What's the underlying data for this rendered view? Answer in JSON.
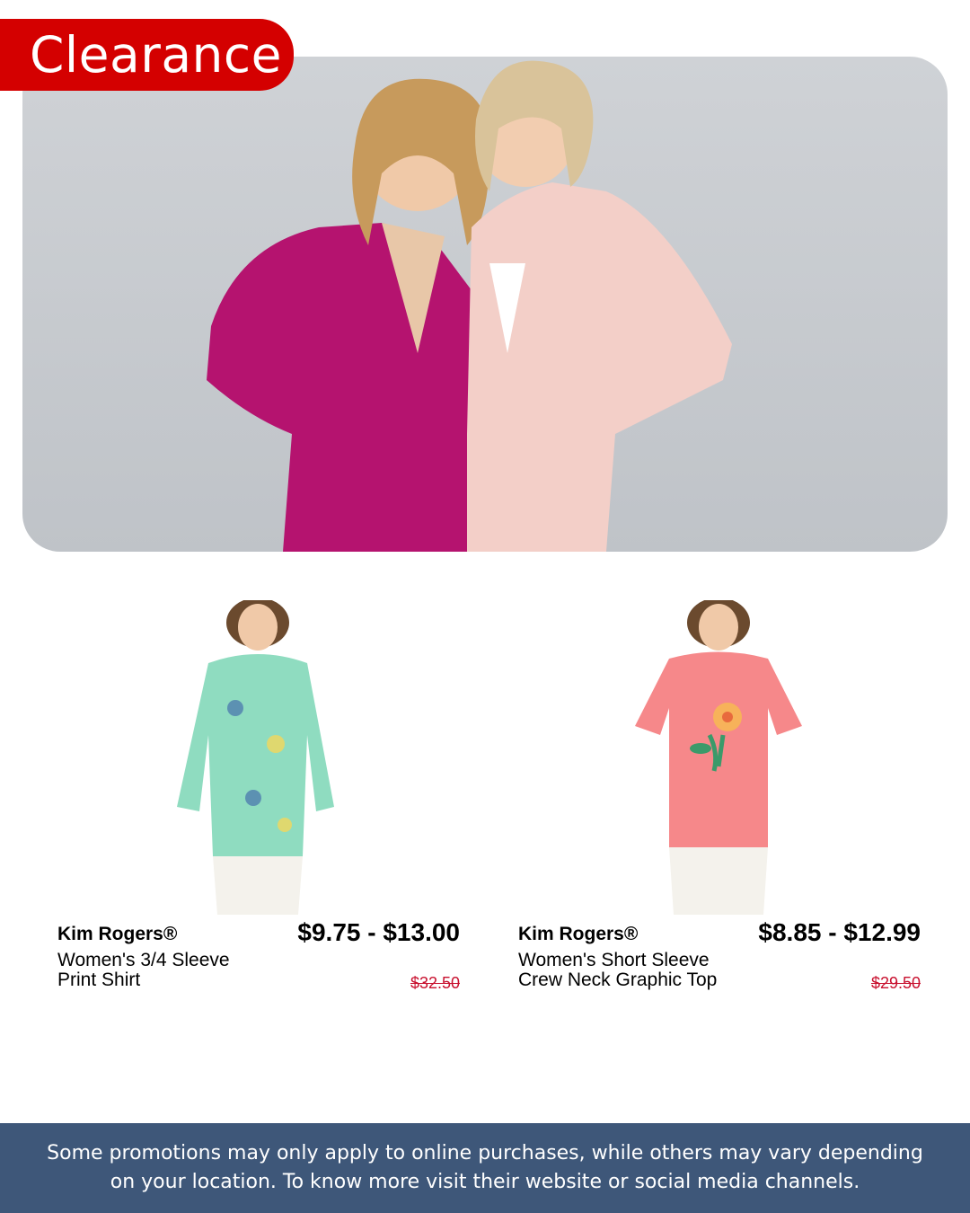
{
  "banner": {
    "label": "Clearance"
  },
  "hero": {
    "image": "two-women-in-blazers-photo"
  },
  "products": [
    {
      "brand": "Kim Rogers®",
      "name": "Women's 3/4 Sleeve Print Shirt",
      "price": "$9.75 - $13.00",
      "original_price": "$32.50",
      "image": "green-paisley-shirt-photo"
    },
    {
      "brand": "Kim Rogers®",
      "name": "Women's Short Sleeve Crew Neck Graphic Top",
      "price": "$8.85 - $12.99",
      "original_price": "$29.50",
      "image": "pink-floral-graphic-top-photo"
    }
  ],
  "footer": {
    "text": "Some promotions may only apply to online purchases, while others may vary depending on your location. To know more visit their website or social media channels."
  },
  "colors": {
    "ribbon": "#d40000",
    "footer_bg": "#3e5779",
    "strike_price": "#c8102e"
  }
}
